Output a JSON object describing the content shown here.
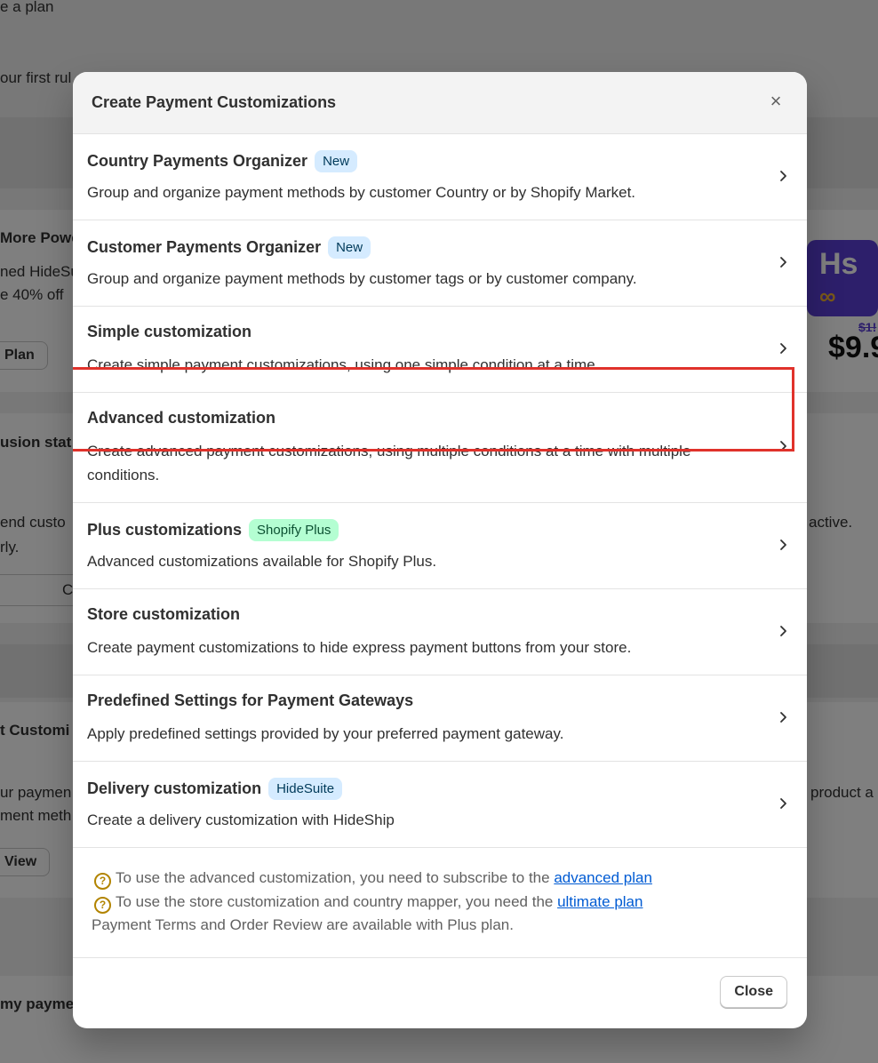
{
  "background": {
    "fragments": [
      "e a plan",
      "our first rul",
      "More Powe",
      "ned HideSu",
      "e 40% off",
      "Plan",
      "usion stat",
      "end custo",
      "rly.",
      "active.",
      "C",
      "t Customi",
      "ur paymen",
      "ment meth",
      "product a",
      "View",
      "my paymen",
      "$9.9",
      "$1!"
    ],
    "promo_logo": "Hs",
    "promo_symbol": "∞"
  },
  "modal": {
    "title": "Create Payment Customizations",
    "close_icon": "×",
    "highlight_color": "#e0322b",
    "items": [
      {
        "title": "Country Payments Organizer",
        "badge": "New",
        "badge_tone": "info",
        "description": "Group and organize payment methods by customer Country or by Shopify Market."
      },
      {
        "title": "Customer Payments Organizer",
        "badge": "New",
        "badge_tone": "info",
        "description": "Group and organize payment methods by customer tags or by customer company."
      },
      {
        "title": "Simple customization",
        "badge": "",
        "badge_tone": "",
        "description": "Create simple payment customizations, using one simple condition at a time."
      },
      {
        "title": "Advanced customization",
        "badge": "",
        "badge_tone": "",
        "description": "Create advanced payment customizations, using multiple conditions at a time with multiple conditions."
      },
      {
        "title": "Plus customizations",
        "badge": "Shopify Plus",
        "badge_tone": "success",
        "description": "Advanced customizations available for Shopify Plus."
      },
      {
        "title": "Store customization",
        "badge": "",
        "badge_tone": "",
        "description": "Create payment customizations to hide express payment buttons from your store."
      },
      {
        "title": "Predefined Settings for Payment Gateways",
        "badge": "",
        "badge_tone": "",
        "description": "Apply predefined settings provided by your preferred payment gateway."
      },
      {
        "title": "Delivery customization",
        "badge": "HideSuite",
        "badge_tone": "info",
        "description": "Create a delivery customization with HideShip"
      }
    ],
    "notes": {
      "line1_text": "To use the advanced customization, you need to subscribe to the ",
      "line1_link": "advanced plan",
      "line2_text": "To use the store customization and country mapper, you need the ",
      "line2_link": "ultimate plan",
      "line3_text": "Payment Terms and Order Review are available with Plus plan."
    },
    "close_button": "Close"
  }
}
